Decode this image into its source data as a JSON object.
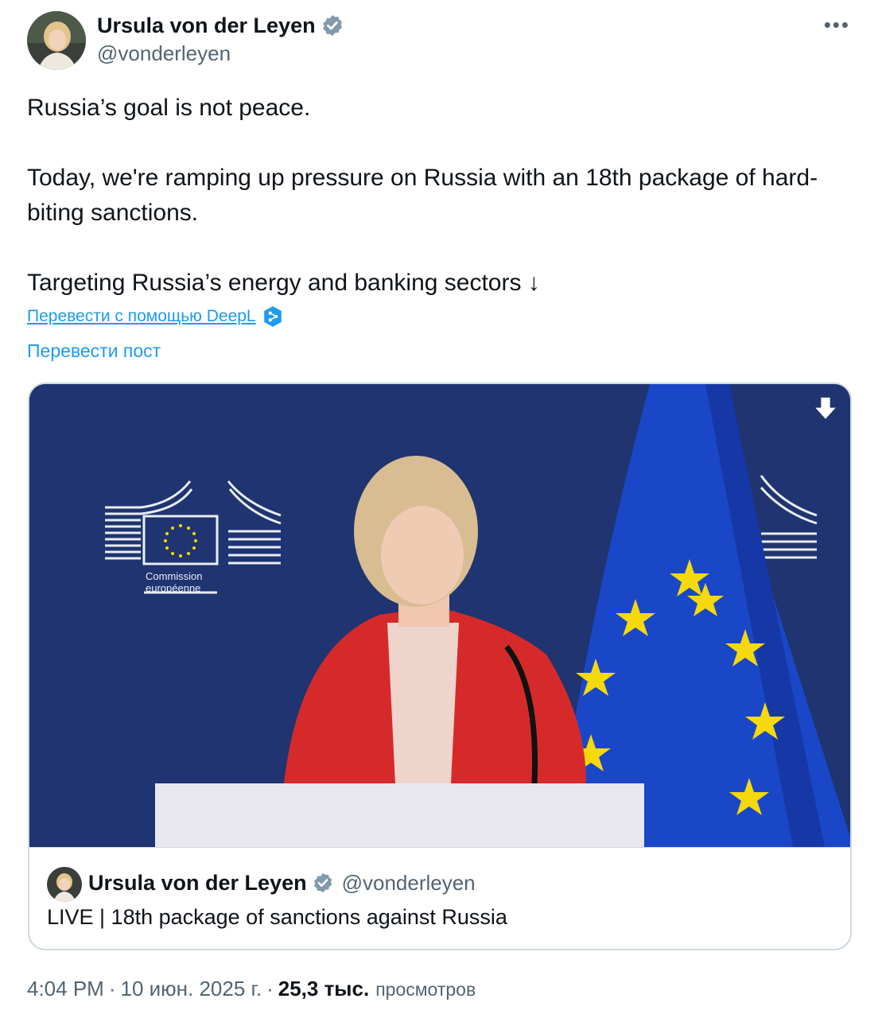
{
  "author": {
    "name": "Ursula von der Leyen",
    "handle": "@vonderleyen",
    "verified": true,
    "avatar_icon": "user-avatar-photo"
  },
  "more_icon": "ellipsis-icon",
  "more_label": "•••",
  "tweet": {
    "line1": "Russia’s goal is not peace.",
    "line2": "Today, we're ramping up pressure on Russia with an 18th package of hard-biting sanctions.",
    "line3": "Targeting Russia’s energy and banking sectors ↓"
  },
  "deepl_label": "Перевести с помощью DeepL",
  "translate_label": "Перевести пост",
  "card": {
    "author_name": "Ursula von der Leyen",
    "author_handle": "@vonderleyen",
    "title": "LIVE | 18th package of sanctions against Russia",
    "media_logo_line1": "Commission",
    "media_logo_line2": "européenne",
    "download_icon": "download-arrow-icon"
  },
  "meta": {
    "time": "4:04 PM",
    "date": "10 июн. 2025 г.",
    "views_count": "25,3 тыс.",
    "views_label": "просмотров",
    "separator": "·"
  },
  "colors": {
    "accent": "#1d9bf0",
    "verified_badge": "#829aab",
    "media_bg": "#1f3470",
    "flag_blue": "#1a47c8",
    "flag_star": "#f5d90a",
    "jacket_red": "#d62a2a"
  }
}
